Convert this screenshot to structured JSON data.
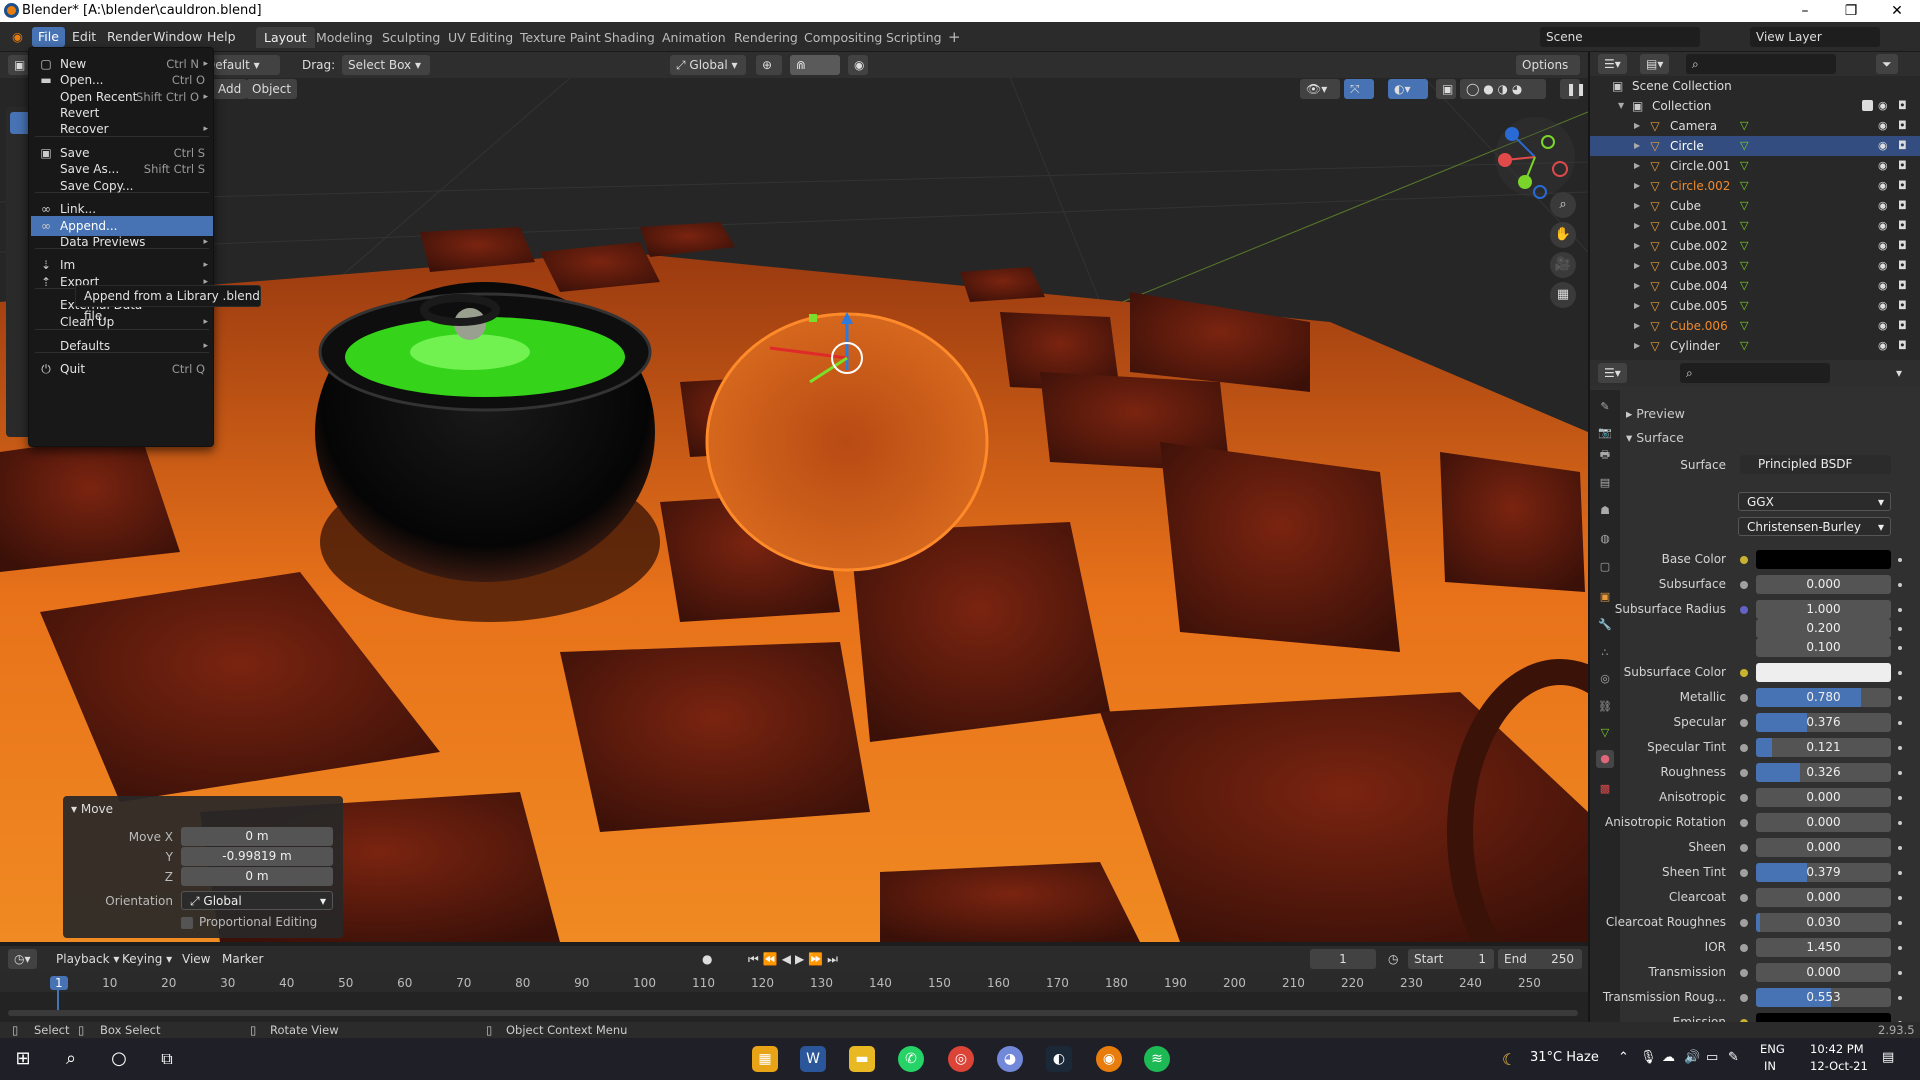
{
  "window": {
    "title": "Blender* [A:\\blender\\cauldron.blend]",
    "minimize": "–",
    "maximize": "❐",
    "close": "✕"
  },
  "menubar": {
    "menus": [
      "File",
      "Edit",
      "Render",
      "Window",
      "Help"
    ],
    "workspaces": [
      "Layout",
      "Modeling",
      "Sculpting",
      "UV Editing",
      "Texture Paint",
      "Shading",
      "Animation",
      "Rendering",
      "Compositing",
      "Scripting"
    ],
    "add_workspace": "+",
    "scene": "Scene",
    "view_layer": "View Layer"
  },
  "viewport_header": {
    "mode_dropdown": "Default",
    "drag_label": "Drag:",
    "drag_value": "Select Box",
    "orientation": "Global",
    "options": "Options",
    "add": "Add",
    "object": "Object"
  },
  "file_menu": {
    "items": [
      {
        "icon": "new-icon",
        "glyph": "▢",
        "label": "New",
        "shortcut": "Ctrl N",
        "arrow": "▸"
      },
      {
        "icon": "folder-icon",
        "glyph": "▬",
        "label": "Open...",
        "shortcut": "Ctrl O",
        "arrow": ""
      },
      {
        "icon": "",
        "glyph": "",
        "label": "Open Recent",
        "shortcut": "Shift Ctrl O",
        "arrow": "▸"
      },
      {
        "icon": "",
        "glyph": "",
        "label": "Revert",
        "shortcut": "",
        "arrow": ""
      },
      {
        "icon": "",
        "glyph": "",
        "label": "Recover",
        "shortcut": "",
        "arrow": "▸"
      },
      {
        "icon": "save-icon",
        "glyph": "▣",
        "label": "Save",
        "shortcut": "Ctrl S",
        "arrow": ""
      },
      {
        "icon": "",
        "glyph": "",
        "label": "Save As...",
        "shortcut": "Shift Ctrl S",
        "arrow": ""
      },
      {
        "icon": "",
        "glyph": "",
        "label": "Save Copy...",
        "shortcut": "",
        "arrow": ""
      },
      {
        "icon": "link-icon",
        "glyph": "∞",
        "label": "Link...",
        "shortcut": "",
        "arrow": ""
      },
      {
        "icon": "append-icon",
        "glyph": "∞",
        "label": "Append...",
        "shortcut": "",
        "arrow": ""
      },
      {
        "icon": "",
        "glyph": "",
        "label": "Data Previews",
        "shortcut": "",
        "arrow": "▸"
      },
      {
        "icon": "import-icon",
        "glyph": "⇣",
        "label": "Im",
        "shortcut": "",
        "arrow": "▸"
      },
      {
        "icon": "export-icon",
        "glyph": "⇡",
        "label": "Export",
        "shortcut": "",
        "arrow": "▸"
      },
      {
        "icon": "",
        "glyph": "",
        "label": "External Data",
        "shortcut": "",
        "arrow": "▸"
      },
      {
        "icon": "",
        "glyph": "",
        "label": "Clean Up",
        "shortcut": "",
        "arrow": "▸"
      },
      {
        "icon": "",
        "glyph": "",
        "label": "Defaults",
        "shortcut": "",
        "arrow": "▸"
      },
      {
        "icon": "quit-icon",
        "glyph": "⏻",
        "label": "Quit",
        "shortcut": "Ctrl Q",
        "arrow": ""
      }
    ],
    "highlighted": "Append...",
    "tooltip": "Append from a Library .blend file."
  },
  "move_panel": {
    "title": "Move",
    "move_x_label": "Move X",
    "move_x": "0 m",
    "y_label": "Y",
    "y": "-0.99819 m",
    "z_label": "Z",
    "z": "0 m",
    "orientation_label": "Orientation",
    "orientation": "Global",
    "proportional": "Proportional Editing"
  },
  "outliner": {
    "scene_collection": "Scene Collection",
    "collection": "Collection",
    "items": [
      {
        "name": "Camera",
        "color": "#dddddd",
        "selected": false
      },
      {
        "name": "Circle",
        "color": "#ffffff",
        "selected": true
      },
      {
        "name": "Circle.001",
        "color": "#dddddd",
        "selected": false
      },
      {
        "name": "Circle.002",
        "color": "#f08a2c",
        "selected": false
      },
      {
        "name": "Cube",
        "color": "#dddddd",
        "selected": false
      },
      {
        "name": "Cube.001",
        "color": "#dddddd",
        "selected": false
      },
      {
        "name": "Cube.002",
        "color": "#dddddd",
        "selected": false
      },
      {
        "name": "Cube.003",
        "color": "#dddddd",
        "selected": false
      },
      {
        "name": "Cube.004",
        "color": "#dddddd",
        "selected": false
      },
      {
        "name": "Cube.005",
        "color": "#dddddd",
        "selected": false
      },
      {
        "name": "Cube.006",
        "color": "#f08a2c",
        "selected": false
      },
      {
        "name": "Cylinder",
        "color": "#dddddd",
        "selected": false
      }
    ]
  },
  "properties": {
    "preview": "Preview",
    "surface_panel": "Surface",
    "surface_label": "Surface",
    "surface_value": "Principled BSDF",
    "distribution": "GGX",
    "subsurface_method": "Christensen-Burley",
    "rows": [
      {
        "label": "Base Color",
        "value": "",
        "fill": 0,
        "swatch": "#000000",
        "dot": "#c9b22e"
      },
      {
        "label": "Subsurface",
        "value": "0.000",
        "fill": 0,
        "swatch": "",
        "dot": "#a0a0a0"
      },
      {
        "label": "Subsurface Radius",
        "value": "1.000",
        "fill": 0,
        "swatch": "",
        "dot": "#6363c7"
      },
      {
        "label": "",
        "value": "0.200",
        "fill": 0,
        "swatch": "",
        "dot": ""
      },
      {
        "label": "",
        "value": "0.100",
        "fill": 0,
        "swatch": "",
        "dot": ""
      },
      {
        "label": "Subsurface Color",
        "value": "",
        "fill": 0,
        "swatch": "#eeeeee",
        "dot": "#c9b22e"
      },
      {
        "label": "Metallic",
        "value": "0.780",
        "fill": 0.78,
        "swatch": "",
        "dot": "#a0a0a0"
      },
      {
        "label": "Specular",
        "value": "0.376",
        "fill": 0.376,
        "swatch": "",
        "dot": "#a0a0a0"
      },
      {
        "label": "Specular Tint",
        "value": "0.121",
        "fill": 0.121,
        "swatch": "",
        "dot": "#a0a0a0"
      },
      {
        "label": "Roughness",
        "value": "0.326",
        "fill": 0.326,
        "swatch": "",
        "dot": "#a0a0a0"
      },
      {
        "label": "Anisotropic",
        "value": "0.000",
        "fill": 0,
        "swatch": "",
        "dot": "#a0a0a0"
      },
      {
        "label": "Anisotropic Rotation",
        "value": "0.000",
        "fill": 0,
        "swatch": "",
        "dot": "#a0a0a0"
      },
      {
        "label": "Sheen",
        "value": "0.000",
        "fill": 0,
        "swatch": "",
        "dot": "#a0a0a0"
      },
      {
        "label": "Sheen Tint",
        "value": "0.379",
        "fill": 0.379,
        "swatch": "",
        "dot": "#a0a0a0"
      },
      {
        "label": "Clearcoat",
        "value": "0.000",
        "fill": 0,
        "swatch": "",
        "dot": "#a0a0a0"
      },
      {
        "label": "Clearcoat Roughnes",
        "value": "0.030",
        "fill": 0.03,
        "swatch": "",
        "dot": "#a0a0a0"
      },
      {
        "label": "IOR",
        "value": "1.450",
        "fill": 0,
        "swatch": "",
        "dot": "#a0a0a0"
      },
      {
        "label": "Transmission",
        "value": "0.000",
        "fill": 0,
        "swatch": "",
        "dot": "#a0a0a0"
      },
      {
        "label": "Transmission Roug...",
        "value": "0.553",
        "fill": 0.553,
        "swatch": "",
        "dot": "#a0a0a0"
      },
      {
        "label": "Emission",
        "value": "",
        "fill": 0,
        "swatch": "#000000",
        "dot": "#c9b22e"
      }
    ]
  },
  "timeline": {
    "playback": "Playback",
    "keying": "Keying",
    "view": "View",
    "marker": "Marker",
    "current_frame": "1",
    "start_label": "Start",
    "start": "1",
    "end_label": "End",
    "end": "250",
    "ticks": [
      "1",
      "10",
      "20",
      "30",
      "40",
      "50",
      "60",
      "70",
      "80",
      "90",
      "100",
      "110",
      "120",
      "130",
      "140",
      "150",
      "160",
      "170",
      "180",
      "190",
      "200",
      "210",
      "220",
      "230",
      "240",
      "250"
    ]
  },
  "statusbar": {
    "select": "Select",
    "box_select": "Box Select",
    "rotate_view": "Rotate View",
    "context_menu": "Object Context Menu",
    "version": "2.93.5"
  },
  "taskbar": {
    "weather": "31°C  Haze",
    "lang": "ENG",
    "region": "IN",
    "time": "10:42 PM",
    "date": "12-Oct-21"
  }
}
